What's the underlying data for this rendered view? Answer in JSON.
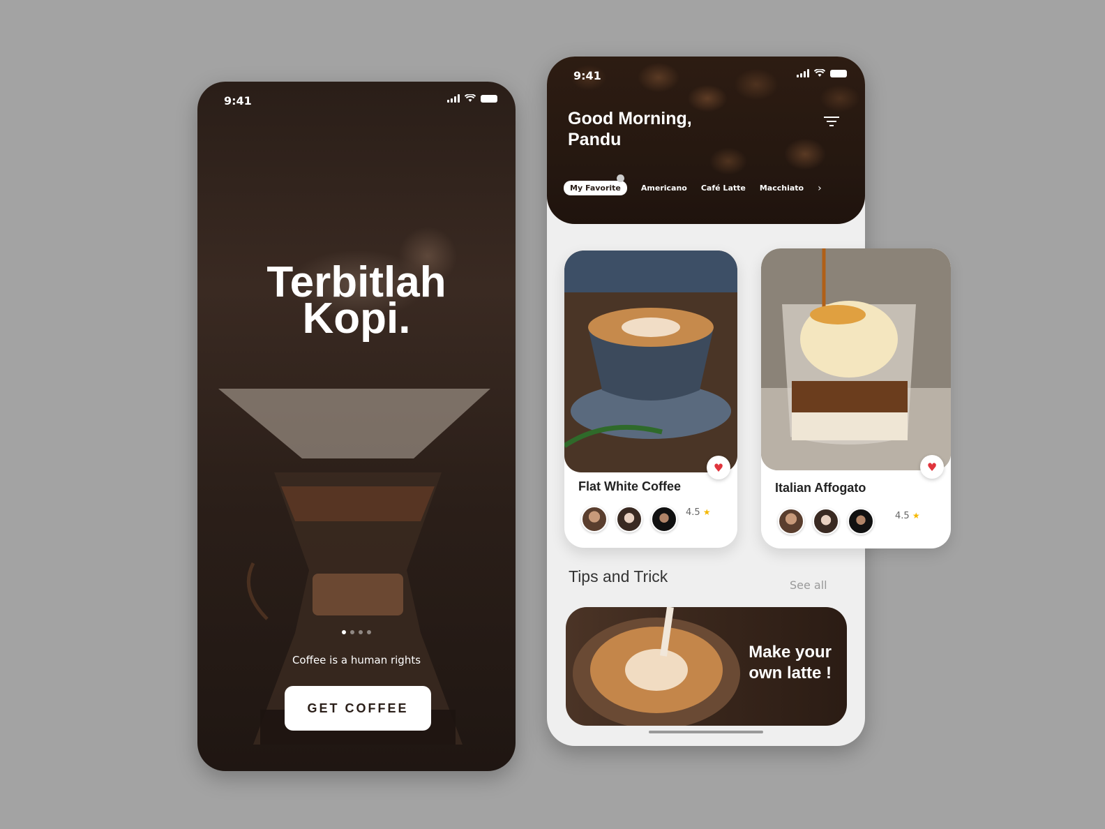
{
  "splash": {
    "status_time": "9:41",
    "title_line1": "Terbitlah",
    "title_line2": "Kopi.",
    "tagline": "Coffee is a human rights",
    "cta_label": "GET COFFEE"
  },
  "home": {
    "status_time": "9:41",
    "greeting_line1": "Good Morning,",
    "greeting_line2": "Pandu",
    "categories": [
      "My Favorite",
      "Americano",
      "Café Latte",
      "Macchiato"
    ],
    "products": [
      {
        "name": "Flat White Coffee",
        "rating": "4.5"
      },
      {
        "name": "Italian Affogato",
        "rating": "4.5"
      }
    ],
    "tips_title": "Tips and Trick",
    "see_all": "See all",
    "tip_line1": "Make your",
    "tip_line2": "own latte !"
  },
  "icons": [
    "signal-icon",
    "wifi-icon",
    "battery-icon",
    "filter-icon",
    "chevron-right-icon",
    "heart-icon",
    "star-icon"
  ],
  "colors": {
    "brand_dark": "#2a1e18",
    "heart": "#e0343c",
    "star": "#f5b800",
    "background": "#a3a3a3"
  }
}
